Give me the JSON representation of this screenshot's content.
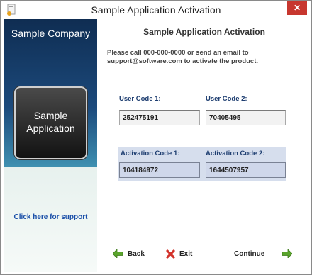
{
  "window": {
    "title": "Sample Application Activation",
    "close_icon": "close-icon"
  },
  "sidebar": {
    "company": "Sample Company",
    "app_name": "Sample Application",
    "support_link": "Click here for support"
  },
  "main": {
    "heading": "Sample Application Activation",
    "message": "Please call 000-000-0000 or send an email to support@software.com to activate the product.",
    "user_code_1_label": "User Code 1:",
    "user_code_1_value": "252475191",
    "user_code_2_label": "User Code 2:",
    "user_code_2_value": "70405495",
    "activation_code_1_label": "Activation Code 1:",
    "activation_code_1_value": "104184972",
    "activation_code_2_label": "Activation Code 2:",
    "activation_code_2_value": "1644507957"
  },
  "buttons": {
    "back": "Back",
    "exit": "Exit",
    "continue": "Continue"
  },
  "colors": {
    "accent_green": "#5aa52c",
    "exit_red": "#d2322a",
    "label_blue": "#1d3d70",
    "close_red": "#c7372f"
  }
}
